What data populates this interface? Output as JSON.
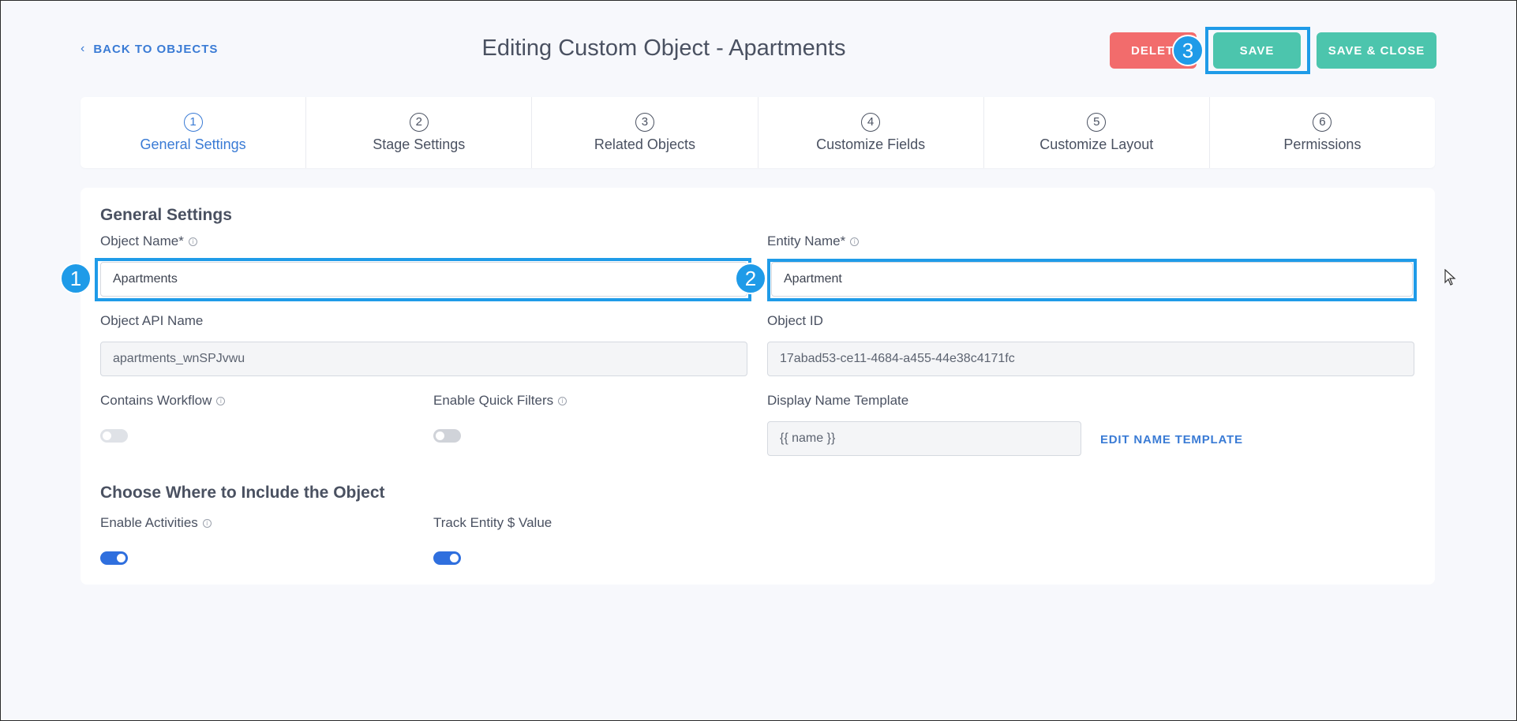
{
  "header": {
    "back_label": "BACK TO OBJECTS",
    "title": "Editing Custom Object - Apartments",
    "delete_label": "DELETE",
    "save_label": "SAVE",
    "save_close_label": "SAVE & CLOSE"
  },
  "steps": [
    {
      "num": "1",
      "label": "General Settings"
    },
    {
      "num": "2",
      "label": "Stage Settings"
    },
    {
      "num": "3",
      "label": "Related Objects"
    },
    {
      "num": "4",
      "label": "Customize Fields"
    },
    {
      "num": "5",
      "label": "Customize Layout"
    },
    {
      "num": "6",
      "label": "Permissions"
    }
  ],
  "general": {
    "title": "General Settings",
    "object_name_label": "Object Name*",
    "object_name_value": "Apartments",
    "entity_name_label": "Entity Name*",
    "entity_name_value": "Apartment",
    "api_name_label": "Object API Name",
    "api_name_value": "apartments_wnSPJvwu",
    "object_id_label": "Object ID",
    "object_id_value": "17abad53-ce11-4684-a455-44e38c4171fc",
    "contains_workflow_label": "Contains Workflow",
    "quick_filters_label": "Enable Quick Filters",
    "display_template_label": "Display Name Template",
    "display_template_value": "{{ name }}",
    "edit_template_label": "EDIT NAME TEMPLATE"
  },
  "include": {
    "title": "Choose Where to Include the Object",
    "activities_label": "Enable Activities",
    "track_value_label": "Track Entity $ Value"
  },
  "toggles": {
    "contains_workflow": false,
    "enable_quick_filters": false,
    "enable_activities": true,
    "track_entity_value": true
  },
  "annotations": [
    "1",
    "2",
    "3"
  ],
  "colors": {
    "accent": "#3a7bd5",
    "save": "#4cc5ad",
    "delete": "#f26c6c",
    "highlight": "#1f9be8"
  }
}
